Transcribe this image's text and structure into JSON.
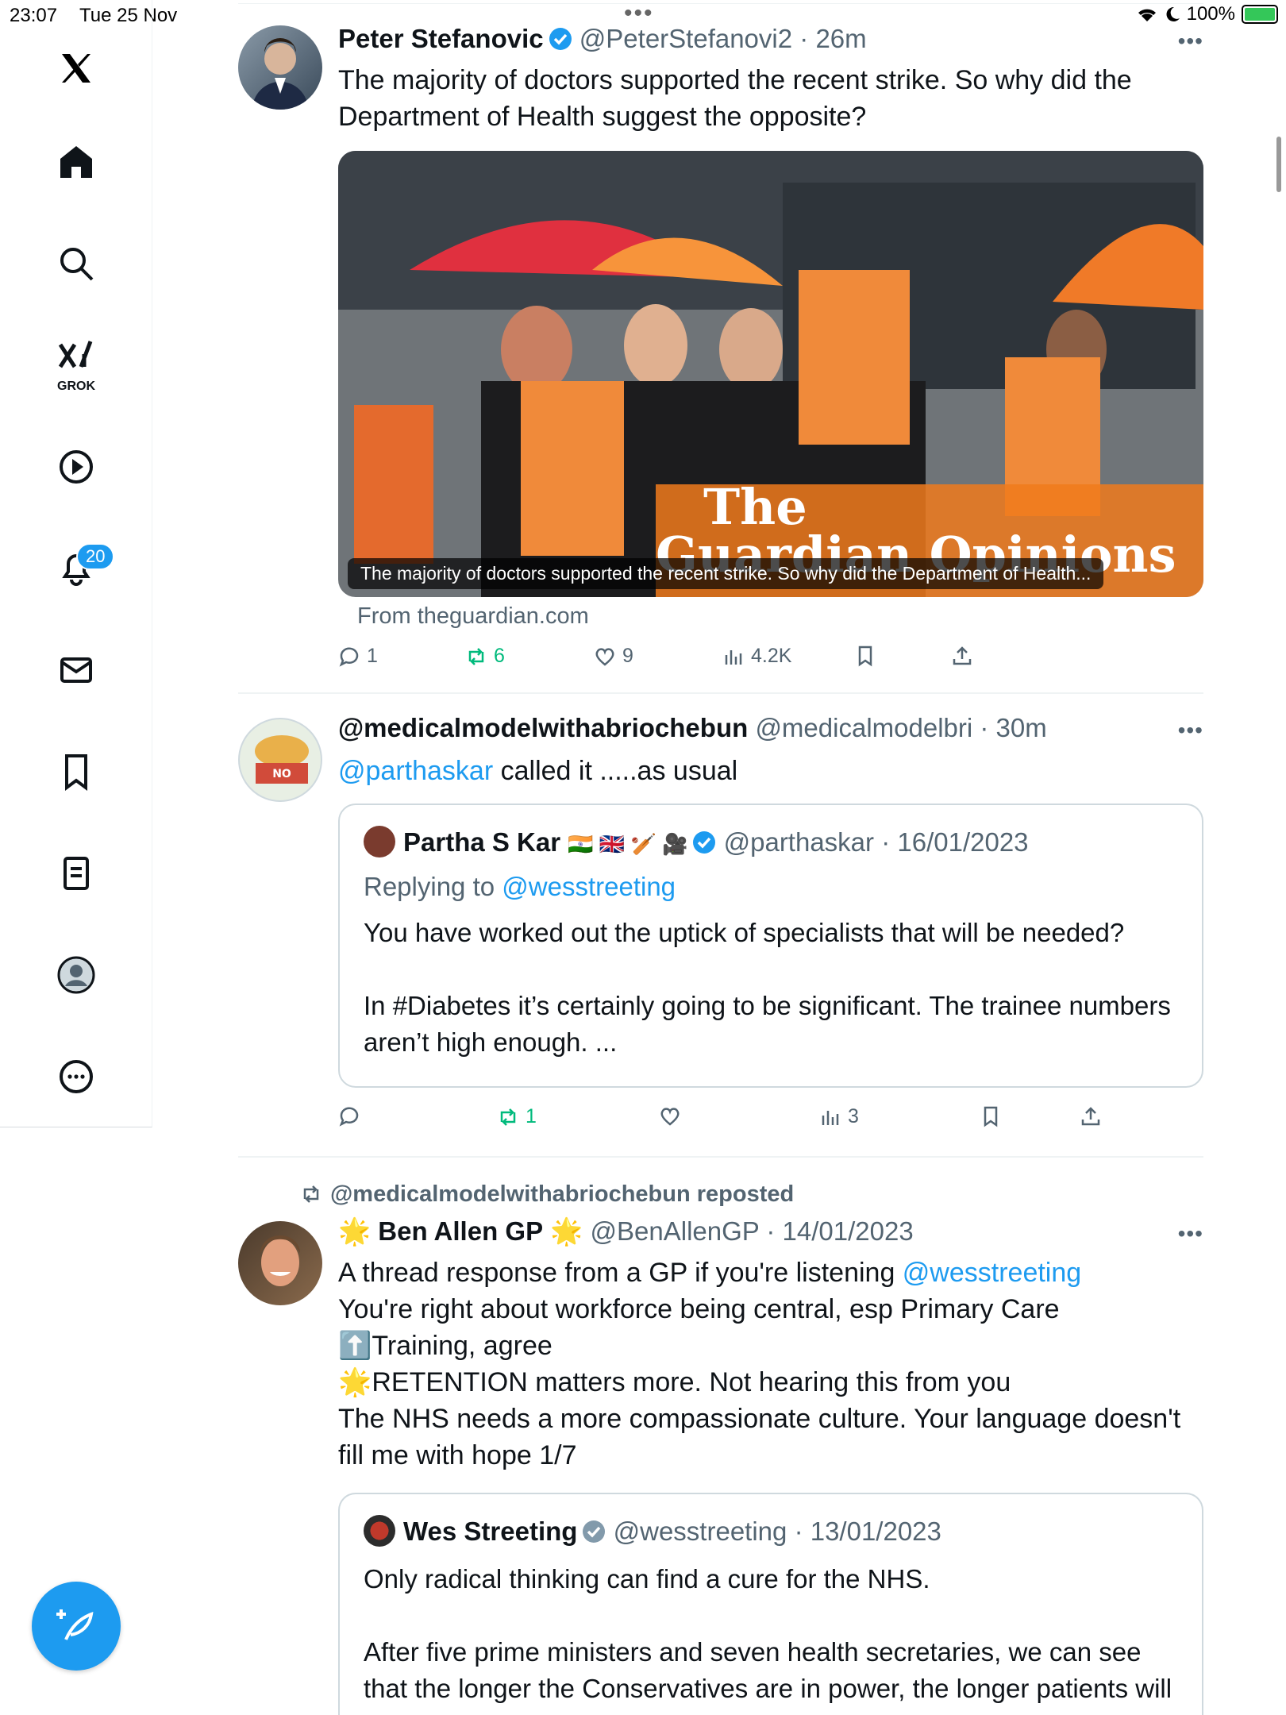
{
  "status": {
    "time": "23:07",
    "date": "Tue 25 Nov",
    "battery": "100%",
    "dots": "•••"
  },
  "sidebar": {
    "grok_label": "GROK",
    "notif_count": "20"
  },
  "colors": {
    "accent": "#1d9bf0",
    "repost_green": "#00ba7c",
    "muted": "#536471"
  },
  "tweets": [
    {
      "name": "Peter Stefanovic",
      "handle": "@PeterStefanovi2",
      "time": "· 26m",
      "more": "•••",
      "text": "The majority of doctors supported the recent strike. So why did the Department of Health suggest the opposite?",
      "card_caption": "The majority of doctors supported the recent strike. So why did the Department of Health...",
      "from": "From theguardian.com",
      "stats": {
        "replies": "1",
        "reposts": "6",
        "likes": "9",
        "views": "4.2K"
      }
    },
    {
      "name": "@medicalmodelwithabriochebun",
      "handle": "@medicalmodelbri",
      "time": "· 30m",
      "more": "•••",
      "text_mention": "@parthaskar",
      "text_rest": " called it .....as usual",
      "quote": {
        "name": "Partha S Kar",
        "emojis": "🇮🇳 🇬🇧 🏏 🎥",
        "handle": "@parthaskar",
        "time": "· 16/01/2023",
        "replying_prefix": "Replying to ",
        "replying_to": "@wesstreeting",
        "para1": "You have worked out the uptick of specialists that will be needed?",
        "para2": "In #Diabetes it’s certainly going to be significant. The trainee numbers aren’t high enough. ..."
      },
      "stats": {
        "replies": "",
        "reposts": "1",
        "likes": "",
        "views": "3"
      }
    },
    {
      "repost_label": "@medicalmodelwithabriochebun reposted",
      "name_prefix": "🌟",
      "name": "Ben Allen GP",
      "name_suffix": "🌟",
      "handle": "@BenAllenGP",
      "time": "· 14/01/2023",
      "more": "•••",
      "line1_text": "A thread response from a GP if you're listening ",
      "line1_mention": "@wesstreeting",
      "line2": "You're right about workforce being central, esp Primary Care",
      "line3": "⬆️Training, agree",
      "line4": "🌟RETENTION matters more. Not hearing this from you",
      "line5": "The NHS needs a more compassionate culture. Your language doesn't fill me with hope 1/7",
      "quote": {
        "name": "Wes Streeting",
        "handle": "@wesstreeting",
        "time": "· 13/01/2023",
        "para1": "Only radical thinking can find a cure for the NHS.",
        "para2": "After five prime ministers and seven health secretaries, we can see that the longer the Conservatives are in power, the longer patients will wait."
      }
    }
  ]
}
